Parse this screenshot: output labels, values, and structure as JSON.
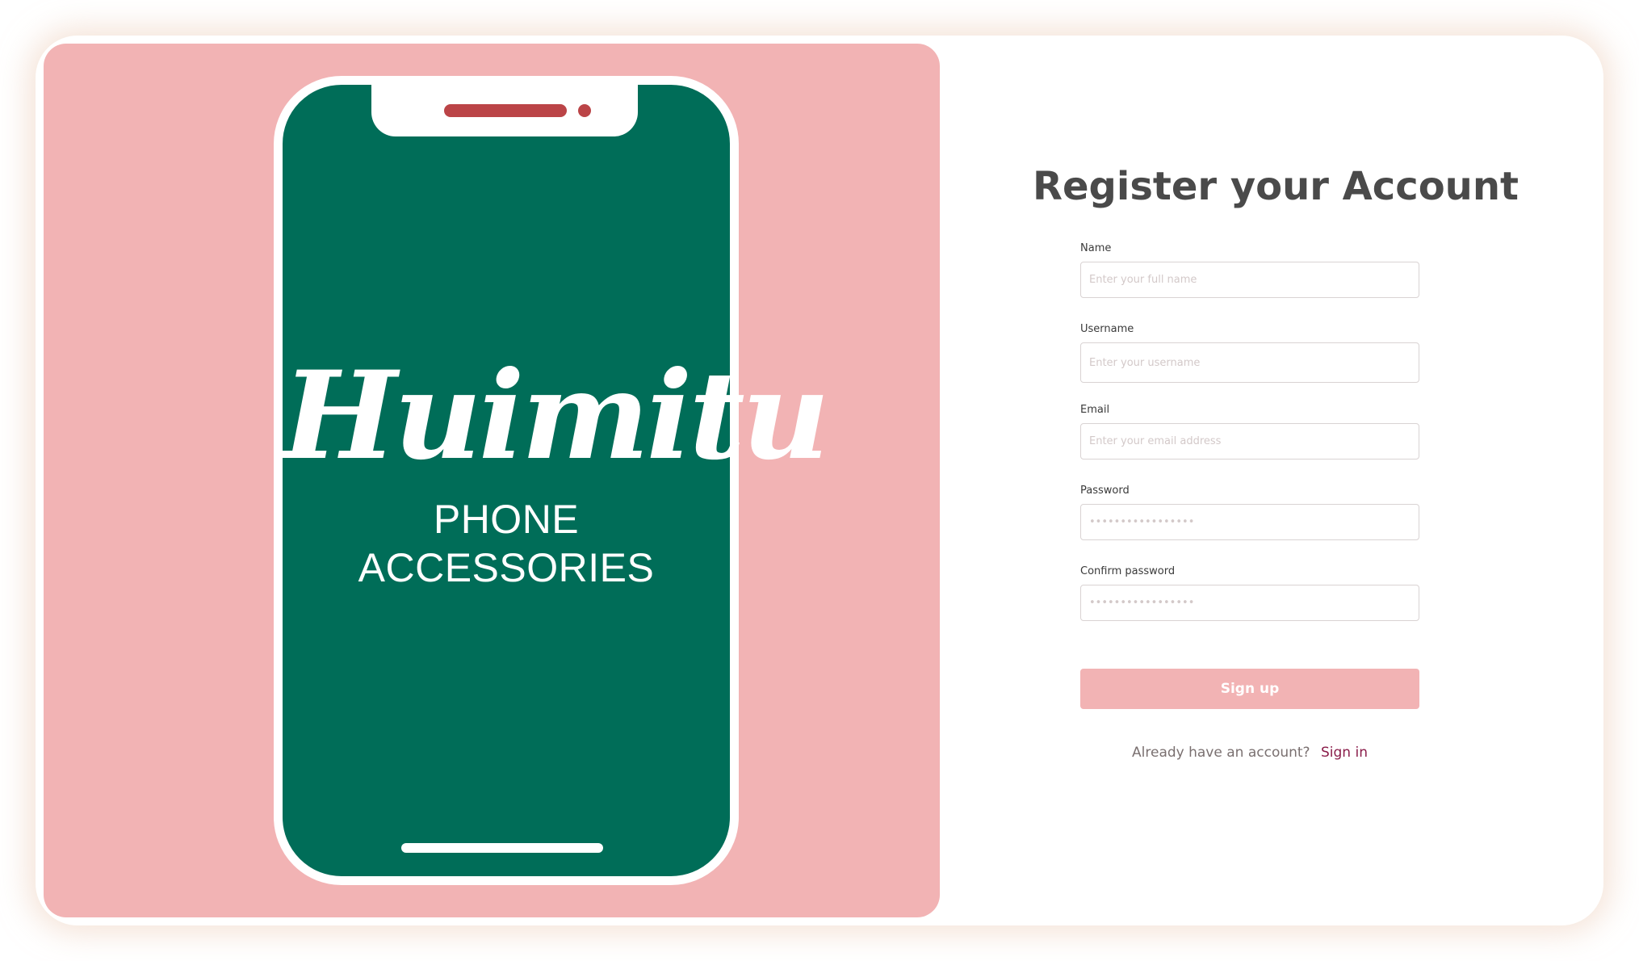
{
  "brand": {
    "script_name": "Huimitu",
    "tagline": "PHONE ACCESSORIES"
  },
  "form": {
    "title": "Register your Account",
    "fields": [
      {
        "label": "Name",
        "placeholder": "Enter your full name",
        "type": "text"
      },
      {
        "label": "Username",
        "placeholder": "Enter your username",
        "type": "text"
      },
      {
        "label": "Email",
        "placeholder": "Enter your email address",
        "type": "email"
      },
      {
        "label": "Password",
        "placeholder": "•••••••••••••••••",
        "type": "password"
      },
      {
        "label": "Confirm password",
        "placeholder": "•••••••••••••••••",
        "type": "password"
      }
    ],
    "submit_label": "Sign up",
    "signin_prompt": "Already have an account?",
    "signin_link": "Sign in"
  },
  "colors": {
    "hero_background": "#f2b3b4",
    "phone_screen": "#006d58",
    "notch_accent": "#bb4447",
    "button_background": "#f2b3b4",
    "link": "#8a1d4a",
    "title_text": "#4a4a4a"
  },
  "icons": {
    "phone_illustration": "smartphone-illustration"
  }
}
